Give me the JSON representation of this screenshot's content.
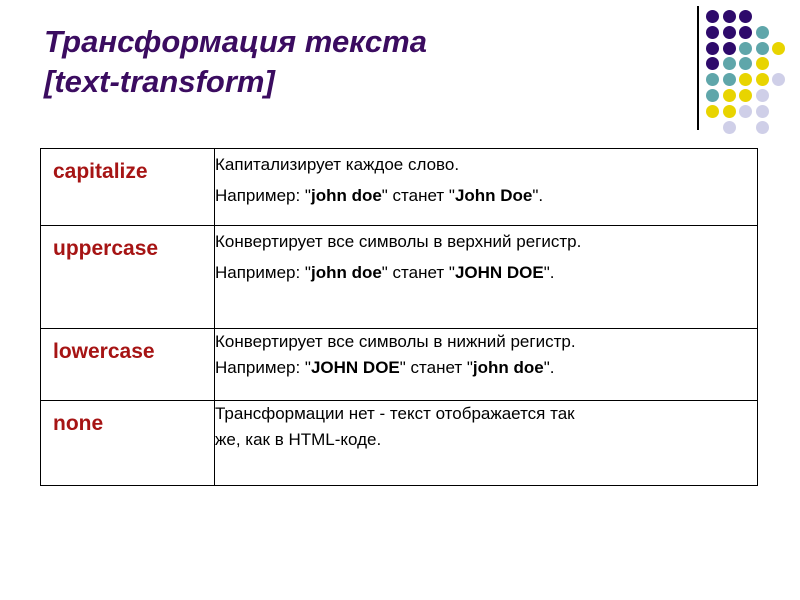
{
  "slide": {
    "title": "Трансформация текста\n[text-transform]",
    "title_color": "#3B0C60"
  },
  "decoration": {
    "name": "dot-grid",
    "rule_color": "#000000",
    "palette": {
      "purple": "#2E0A6B",
      "teal": "#5FA6AA",
      "yellow": "#E8D400",
      "lavender": "#CFCFE8"
    },
    "dots": [
      {
        "col": 0,
        "row": 0,
        "color": "#2E0A6B"
      },
      {
        "col": 1,
        "row": 0,
        "color": "#2E0A6B"
      },
      {
        "col": 2,
        "row": 0,
        "color": "#2E0A6B"
      },
      {
        "col": 0,
        "row": 1,
        "color": "#2E0A6B"
      },
      {
        "col": 1,
        "row": 1,
        "color": "#2E0A6B"
      },
      {
        "col": 2,
        "row": 1,
        "color": "#2E0A6B"
      },
      {
        "col": 3,
        "row": 1,
        "color": "#5FA6AA"
      },
      {
        "col": 0,
        "row": 2,
        "color": "#2E0A6B"
      },
      {
        "col": 1,
        "row": 2,
        "color": "#2E0A6B"
      },
      {
        "col": 2,
        "row": 2,
        "color": "#5FA6AA"
      },
      {
        "col": 3,
        "row": 2,
        "color": "#5FA6AA"
      },
      {
        "col": 4,
        "row": 2,
        "color": "#E8D400"
      },
      {
        "col": 0,
        "row": 3,
        "color": "#2E0A6B"
      },
      {
        "col": 1,
        "row": 3,
        "color": "#5FA6AA"
      },
      {
        "col": 2,
        "row": 3,
        "color": "#5FA6AA"
      },
      {
        "col": 3,
        "row": 3,
        "color": "#E8D400"
      },
      {
        "col": 0,
        "row": 4,
        "color": "#5FA6AA"
      },
      {
        "col": 1,
        "row": 4,
        "color": "#5FA6AA"
      },
      {
        "col": 2,
        "row": 4,
        "color": "#E8D400"
      },
      {
        "col": 3,
        "row": 4,
        "color": "#E8D400"
      },
      {
        "col": 4,
        "row": 4,
        "color": "#CFCFE8"
      },
      {
        "col": 0,
        "row": 5,
        "color": "#5FA6AA"
      },
      {
        "col": 1,
        "row": 5,
        "color": "#E8D400"
      },
      {
        "col": 2,
        "row": 5,
        "color": "#E8D400"
      },
      {
        "col": 3,
        "row": 5,
        "color": "#CFCFE8"
      },
      {
        "col": 0,
        "row": 6,
        "color": "#E8D400"
      },
      {
        "col": 1,
        "row": 6,
        "color": "#E8D400"
      },
      {
        "col": 2,
        "row": 6,
        "color": "#CFCFE8"
      },
      {
        "col": 3,
        "row": 6,
        "color": "#CFCFE8"
      },
      {
        "col": 1,
        "row": 7,
        "color": "#CFCFE8"
      },
      {
        "col": 3,
        "row": 7,
        "color": "#CFCFE8"
      }
    ]
  },
  "table": {
    "label_color": "#A61414",
    "border_color": "#000000",
    "rows": [
      {
        "property": "capitalize",
        "line1_html": "Капитализирует каждое слово.",
        "line2_html": "Например: \"<b>john doe</b>\" станет \"<b>John Doe</b>\".",
        "line1_text": "Капитализирует каждое слово.",
        "line2_text": "Например: \"john doe\" станет \"John Doe\"."
      },
      {
        "property": "uppercase",
        "line1_html": "Конвертирует все символы в верхний регистр.",
        "line2_html": "Например: \"<b>john doe</b>\" станет \"<b>JOHN DOE</b>\".",
        "line1_text": "Конвертирует все символы в верхний регистр.",
        "line2_text": "Например: \"john doe\" станет \"JOHN DOE\"."
      },
      {
        "property": "lowercase",
        "line1_html": "Конвертирует все символы в нижний регистр.",
        "line2_html": "Например: \"<b>JOHN DOE</b>\" станет \"<b>john doe</b>\".",
        "line1_text": "Конвертирует все символы в нижний регистр.",
        "line2_text": "Например: \"JOHN DOE\" станет \"john doe\"."
      },
      {
        "property": "none",
        "line1_html": "Трансформации нет - текст отображается так",
        "line2_html": "же, как в HTML-коде.",
        "line1_text": "Трансформации нет - текст отображается так",
        "line2_text": "же, как в HTML-коде."
      }
    ]
  }
}
